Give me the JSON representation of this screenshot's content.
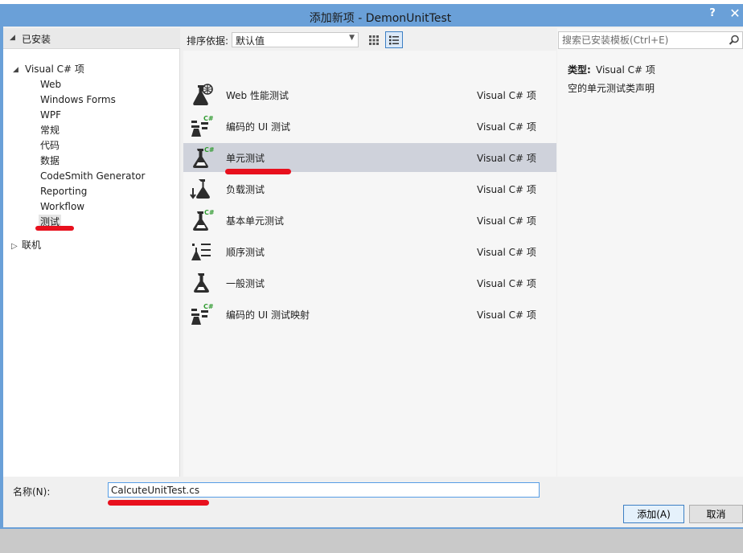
{
  "dialog": {
    "title": "添加新项 - DemonUnitTest",
    "help_label": "?",
    "close_label": "✕"
  },
  "tree": {
    "root_label": "已安装",
    "visual_cs_label": "Visual C# 项",
    "children": [
      "Web",
      "Windows Forms",
      "WPF",
      "常规",
      "代码",
      "数据",
      "CodeSmith Generator",
      "Reporting",
      "Workflow",
      "测试"
    ],
    "selected_child": "测试",
    "online_label": "联机"
  },
  "sort": {
    "label": "排序依据:",
    "selected": "默认值"
  },
  "templates": [
    {
      "name": "Web 性能测试",
      "category": "Visual C# 项",
      "icon": "web-performance-test-icon"
    },
    {
      "name": "编码的 UI 测试",
      "category": "Visual C# 项",
      "icon": "coded-ui-test-icon"
    },
    {
      "name": "单元测试",
      "category": "Visual C# 项",
      "icon": "unit-test-icon",
      "selected": true
    },
    {
      "name": "负载测试",
      "category": "Visual C# 项",
      "icon": "load-test-icon"
    },
    {
      "name": "基本单元测试",
      "category": "Visual C# 项",
      "icon": "basic-unit-test-icon"
    },
    {
      "name": "顺序测试",
      "category": "Visual C# 项",
      "icon": "ordered-test-icon"
    },
    {
      "name": "一般测试",
      "category": "Visual C# 项",
      "icon": "generic-test-icon"
    },
    {
      "name": "编码的 UI 测试映射",
      "category": "Visual C# 项",
      "icon": "coded-ui-test-map-icon"
    }
  ],
  "search": {
    "placeholder": "搜索已安装模板(Ctrl+E)"
  },
  "details": {
    "type_label": "类型:",
    "type_value": "Visual C# 项",
    "description": "空的单元测试类声明"
  },
  "name_field": {
    "label": "名称(N):",
    "value": "CalcuteUnitTest.cs"
  },
  "buttons": {
    "add": "添加(A)",
    "cancel": "取消"
  },
  "colors": {
    "title_bar": "#6aa0d8",
    "selection": "#cfd2db",
    "annotation_mark": "#e8101d",
    "flask_accent": "#2f9a2f"
  }
}
